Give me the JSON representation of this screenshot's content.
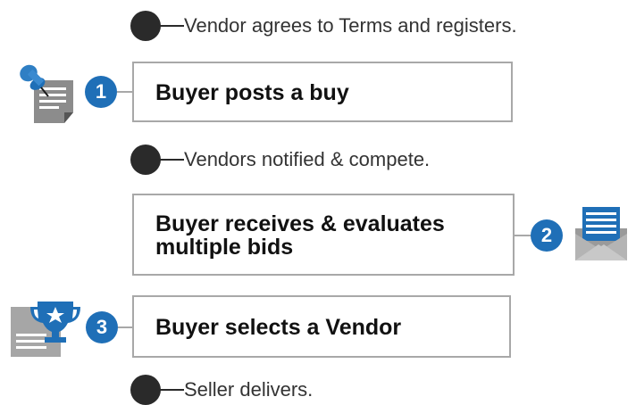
{
  "notes": [
    {
      "text": "Vendor agrees to Terms and registers."
    },
    {
      "text": "Vendors notified & compete."
    },
    {
      "text": "Seller delivers."
    }
  ],
  "steps": [
    {
      "number": "1",
      "label": "Buyer posts a buy",
      "icon": "pushpin-document-icon"
    },
    {
      "number": "2",
      "label_lines": [
        "Buyer receives & evaluates",
        "multiple bids"
      ],
      "icon": "envelope-icon"
    },
    {
      "number": "3",
      "label": "Buyer selects a Vendor",
      "icon": "trophy-document-icon"
    }
  ],
  "colors": {
    "badge": "#1f6fb7",
    "dot": "#2a2a2a",
    "box_border": "#a8a8a8",
    "icon_gray": "#8a8a8a",
    "icon_blue": "#1f6fb7"
  }
}
